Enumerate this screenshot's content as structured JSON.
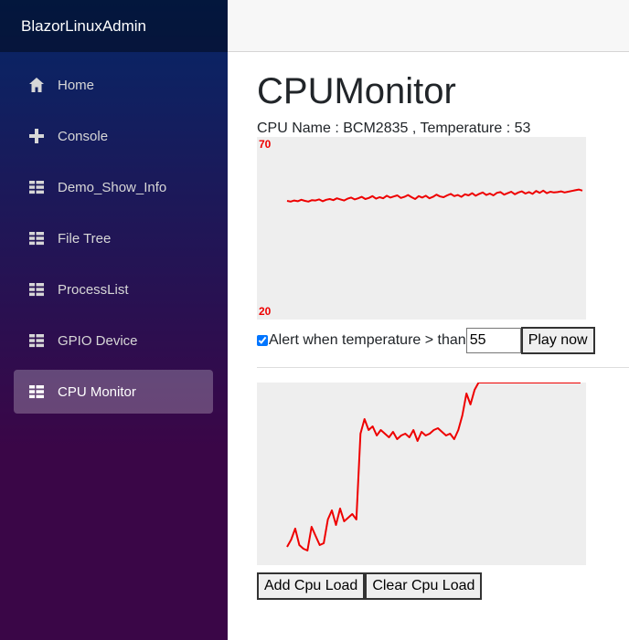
{
  "app": {
    "brand": "BlazorLinuxAdmin"
  },
  "sidebar": {
    "items": [
      {
        "label": "Home",
        "icon": "home-icon"
      },
      {
        "label": "Console",
        "icon": "plus-icon"
      },
      {
        "label": "Demo_Show_Info",
        "icon": "list-icon"
      },
      {
        "label": "File Tree",
        "icon": "list-icon"
      },
      {
        "label": "ProcessList",
        "icon": "list-icon"
      },
      {
        "label": "GPIO Device",
        "icon": "list-icon"
      },
      {
        "label": "CPU Monitor",
        "icon": "list-icon",
        "active": true
      }
    ]
  },
  "page": {
    "title": "CPUMonitor",
    "cpu_info": "CPU Name : BCM2835 , Temperature : 53",
    "alert_label": "Alert when temperature > than",
    "alert_checked": true,
    "alert_threshold": "55",
    "play_button": "Play now",
    "add_load_button": "Add Cpu Load",
    "clear_load_button": "Clear Cpu Load"
  },
  "colors": {
    "line": "#ee0000",
    "chart_bg": "#eeeeee"
  },
  "chart_data": [
    {
      "type": "line",
      "title": "",
      "ylim": [
        20,
        70
      ],
      "tick_labels": [
        "70",
        "20"
      ],
      "series": [
        {
          "values": [
            52.5,
            52.3,
            52.6,
            52.4,
            52.8,
            52.5,
            52.3,
            52.7,
            52.6,
            52.9,
            52.4,
            52.8,
            53.0,
            52.7,
            53.2,
            52.9,
            52.6,
            53.1,
            53.4,
            52.9,
            53.2,
            53.6,
            53.0,
            53.3,
            53.8,
            53.1,
            53.5,
            53.2,
            53.9,
            53.4,
            53.7,
            54.0,
            53.3,
            53.6,
            54.1,
            53.5,
            53.0,
            53.8,
            53.4,
            53.9,
            53.2,
            53.6,
            54.2,
            53.7,
            53.5,
            54.0,
            54.4,
            53.8,
            54.1,
            53.6,
            54.3,
            54.0,
            54.6,
            53.9,
            54.4,
            54.8,
            54.1,
            54.5,
            54.0,
            54.7,
            54.9,
            54.2,
            54.6,
            55.0,
            54.3,
            54.8,
            55.1,
            54.5,
            54.9,
            54.4,
            55.2,
            54.7,
            55.3,
            54.6,
            55.0,
            54.8,
            54.9,
            55.1,
            54.8,
            55.0,
            55.2,
            55.4,
            55.6,
            55.3
          ]
        }
      ]
    },
    {
      "type": "line",
      "title": "",
      "series": [
        {
          "values": [
            10,
            14,
            20,
            11,
            9,
            8,
            21,
            16,
            11,
            12,
            25,
            30,
            22,
            31,
            24,
            26,
            28,
            25,
            72,
            80,
            74,
            76,
            71,
            74,
            72,
            70,
            73,
            69,
            71,
            72,
            70,
            74,
            68,
            73,
            71,
            72,
            74,
            75,
            73,
            71,
            72,
            69,
            74,
            82,
            94,
            88,
            96,
            100,
            100,
            100,
            100,
            100,
            100,
            100,
            100,
            100,
            100,
            100,
            100,
            100,
            100,
            100,
            100,
            100,
            100,
            100,
            100,
            100,
            100,
            100,
            100,
            100,
            100
          ]
        }
      ],
      "ylim": [
        0,
        100
      ]
    }
  ]
}
